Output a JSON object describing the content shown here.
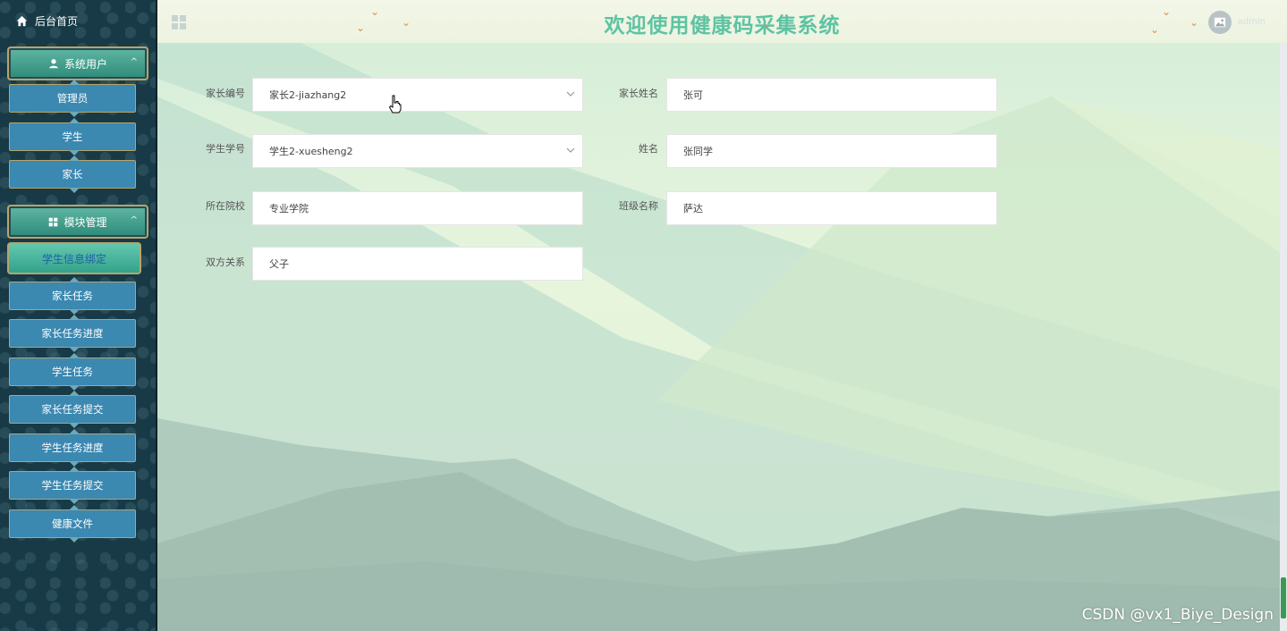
{
  "sidebar": {
    "home_label": "后台首页",
    "groups": [
      {
        "label": "系统用户",
        "items": [
          "管理员",
          "学生",
          "家长"
        ]
      },
      {
        "label": "模块管理",
        "items": [
          "学生信息绑定",
          "家长任务",
          "家长任务进度",
          "学生任务",
          "家长任务提交",
          "学生任务进度",
          "学生任务提交",
          "健康文件"
        ]
      }
    ],
    "active_item": "学生信息绑定"
  },
  "header": {
    "title": "欢迎使用健康码采集系统",
    "username": "admin"
  },
  "form": {
    "parent_no_label": "家长编号",
    "parent_no_value": "家长2-jiazhang2",
    "parent_name_label": "家长姓名",
    "parent_name_value": "张可",
    "student_no_label": "学生学号",
    "student_no_value": "学生2-xuesheng2",
    "student_name_label": "姓名",
    "student_name_value": "张同学",
    "school_label": "所在院校",
    "school_value": "专业学院",
    "class_label": "班级名称",
    "class_value": "萨达",
    "relation_label": "双方关系",
    "relation_value": "父子"
  },
  "watermark": "CSDN @vx1_Biye_Design",
  "colors": {
    "title": "#5dc3a3",
    "nav_item": "#3b88b1",
    "group_head": "#2e8a79",
    "active_text": "#1f5fa8",
    "sidebar_bg": "#173a46"
  }
}
